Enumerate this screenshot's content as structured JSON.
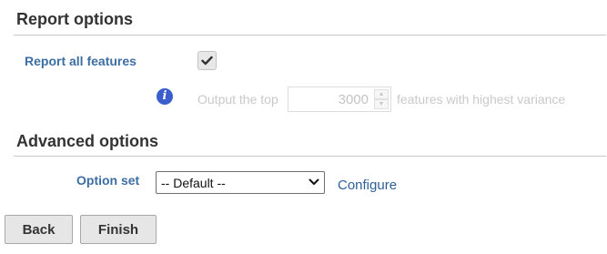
{
  "report_options": {
    "title": "Report options",
    "report_all_label": "Report all features",
    "report_all_checked": true,
    "output_prefix": "Output the top",
    "top_count": "3000",
    "output_suffix": "features with highest variance"
  },
  "advanced_options": {
    "title": "Advanced options",
    "option_set_label": "Option set",
    "option_set_value": "-- Default --",
    "configure_link": "Configure"
  },
  "footer": {
    "back_label": "Back",
    "finish_label": "Finish"
  },
  "icons": {
    "info": "info-icon",
    "checkmark": "checkmark-icon",
    "chevron": "chevron-down-icon"
  },
  "colors": {
    "label_blue": "#3c6ea4",
    "link_blue": "#2e5f98",
    "info_blue": "#3a5fcd",
    "disabled_text": "#c9c9c9"
  }
}
